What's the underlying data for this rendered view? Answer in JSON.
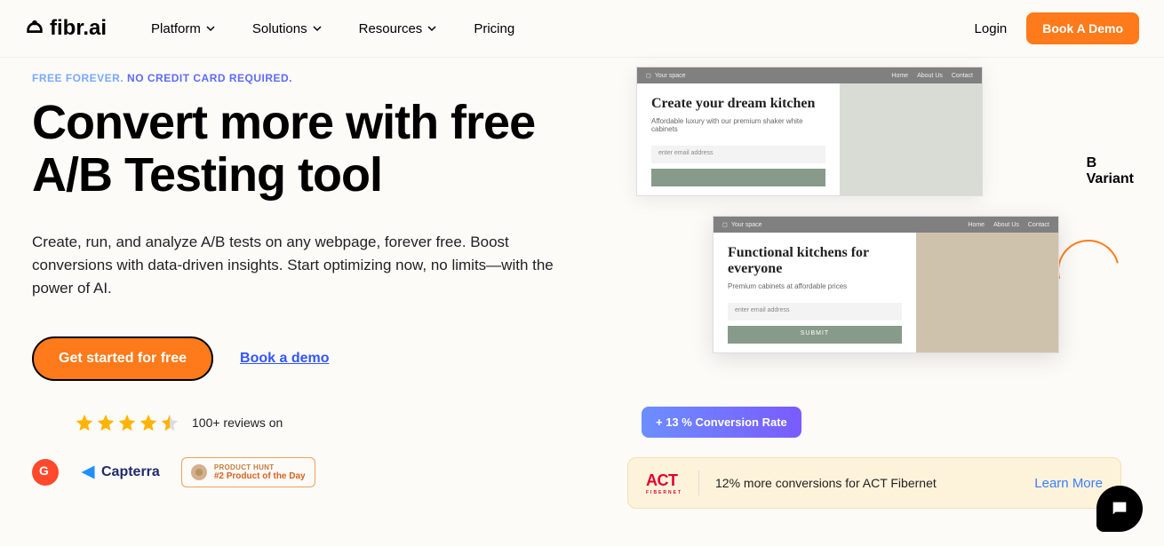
{
  "nav": {
    "logo": "fibr.ai",
    "items": [
      {
        "label": "Platform",
        "has_dropdown": true
      },
      {
        "label": "Solutions",
        "has_dropdown": true
      },
      {
        "label": "Resources",
        "has_dropdown": true
      },
      {
        "label": "Pricing",
        "has_dropdown": false
      }
    ],
    "login": "Login",
    "demo_button": "Book A Demo"
  },
  "hero": {
    "eyebrow_part1": "FREE FOREVER.",
    "eyebrow_part2": "NO CREDIT CARD REQUIRED.",
    "headline": "Convert more with free A/B Testing tool",
    "subhead": "Create, run, and analyze A/B tests on any webpage, forever free. Boost conversions with data-driven insights. Start optimizing now, no limits—with the power of AI.",
    "cta_primary": "Get started for free",
    "cta_link": "Book a demo"
  },
  "reviews": {
    "rating": 4.5,
    "text": "100+ reviews on"
  },
  "badges": {
    "capterra": "Capterra",
    "ph_top": "PRODUCT HUNT",
    "ph_bottom": "#2 Product of the Day"
  },
  "mockups": {
    "variant_a": {
      "brand": "Your space",
      "nav": [
        "Home",
        "About Us",
        "Contact"
      ],
      "title": "Create your dream kitchen",
      "sub": "Affordable luxury with our premium shaker white cabinets",
      "placeholder": "enter email address"
    },
    "variant_b": {
      "brand": "Your space",
      "nav": [
        "Home",
        "About Us",
        "Contact"
      ],
      "title": "Functional kitchens for everyone",
      "sub": "Premium cabinets at affordable prices",
      "placeholder": "enter email address",
      "submit": "SUBMIT"
    },
    "variant_label_b": "B",
    "variant_label": "Variant",
    "conv_badge": "+ 13 % Conversion Rate"
  },
  "callout": {
    "logo": "ACT",
    "logo_sub": "FIBERNET",
    "text": "12% more conversions for ACT Fibernet",
    "link": "Learn More"
  }
}
